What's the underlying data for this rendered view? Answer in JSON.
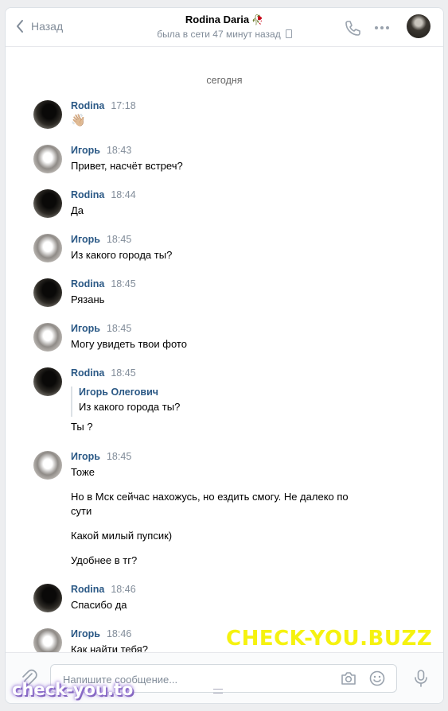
{
  "header": {
    "back_label": "Назад",
    "contact_name": "Rodina Daria",
    "name_emoji": "🥀",
    "status": "была в сети 47 минут назад"
  },
  "date_divider": "сегодня",
  "messages": [
    {
      "author": "Rodina",
      "time": "17:18",
      "lines": [
        "👋🏼"
      ]
    },
    {
      "author": "Игорь",
      "time": "18:43",
      "lines": [
        "Привет, насчёт встреч?"
      ]
    },
    {
      "author": "Rodina",
      "time": "18:44",
      "lines": [
        "Да"
      ]
    },
    {
      "author": "Игорь",
      "time": "18:45",
      "lines": [
        "Из какого города ты?"
      ]
    },
    {
      "author": "Rodina",
      "time": "18:45",
      "lines": [
        "Рязань"
      ]
    },
    {
      "author": "Игорь",
      "time": "18:45",
      "lines": [
        "Могу увидеть твои фото"
      ]
    },
    {
      "author": "Rodina",
      "time": "18:45",
      "reply": {
        "name": "Игорь Олегович",
        "text": "Из какого города ты?"
      },
      "lines": [
        "Ты ?"
      ]
    },
    {
      "author": "Игорь",
      "time": "18:45",
      "lines": [
        "Тоже",
        "Но в Мск сейчас нахожусь, но ездить смогу. Не далеко по",
        "сути",
        "Какой милый пупсик)",
        "Удобнее в тг?"
      ]
    },
    {
      "author": "Rodina",
      "time": "18:46",
      "lines": [
        "Спасибо да"
      ]
    },
    {
      "author": "Игорь",
      "time": "18:46",
      "lines": [
        "Как найти тебя?"
      ]
    }
  ],
  "composer": {
    "placeholder": "Напишите сообщение..."
  },
  "watermarks": {
    "main": "CHECK-YOU.BUZZ",
    "corner": "check-you.to"
  },
  "colors": {
    "author_name": "#2a5885",
    "muted": "#818c99",
    "watermark_main": "#f5f20f"
  },
  "icons": [
    "chevron-left-icon",
    "phone-icon",
    "more-icon",
    "paperclip-icon",
    "camera-icon",
    "smile-icon",
    "microphone-icon"
  ]
}
